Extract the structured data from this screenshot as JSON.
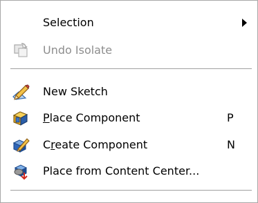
{
  "menu": {
    "selection": {
      "label": "Selection",
      "icon": "submenu-arrow-icon"
    },
    "undo_isolate": {
      "label": "Undo Isolate",
      "enabled": false,
      "icon": "undo-isolate-icon"
    },
    "new_sketch": {
      "label": "New Sketch",
      "icon": "new-sketch-icon"
    },
    "place_component": {
      "label_mnemonic": "P",
      "label_rest": "lace Component",
      "shortcut": "P",
      "icon": "place-component-icon"
    },
    "create_component": {
      "label_pre": "C",
      "label_mnemonic": "r",
      "label_rest": "eate Component",
      "shortcut": "N",
      "icon": "create-component-icon"
    },
    "place_from_content_center": {
      "label": "Place from Content Center...",
      "icon": "content-center-icon"
    }
  },
  "colors": {
    "text": "#000000",
    "disabled_text": "#8d8d8d",
    "separator": "#a0a0a0",
    "border": "#a7a7a7"
  }
}
